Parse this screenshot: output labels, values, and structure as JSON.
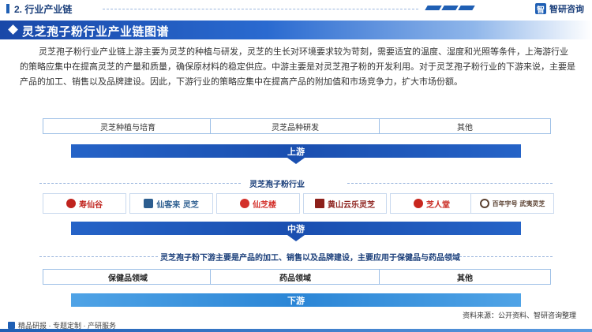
{
  "header": {
    "section_title": "2. 行业产业链",
    "brand_name": "智研咨询",
    "brand_logo_letter": "智"
  },
  "title": "灵芝孢子粉行业产业链图谱",
  "intro": "灵芝孢子粉行业产业链上游主要为灵芝的种植与研发，灵芝的生长对环境要求较为苛刻，需要适宜的温度、湿度和光照等条件，上海游行业的策略应集中在提高灵芝的产量和质量，确保原材料的稳定供应。中游主要是对灵芝孢子粉的开发利用。对于灵芝孢子粉行业的下游来说，主要是产品的加工、销售以及品牌建设。因此，下游行业的策略应集中在提高产品的附加值和市场竞争力，扩大市场份额。",
  "upstream": {
    "items": [
      "灵芝种植与培育",
      "灵芝品种研发",
      "其他"
    ],
    "label": "上游"
  },
  "midstream": {
    "heading": "灵芝孢子粉行业",
    "logos": [
      {
        "name": "寿仙谷",
        "color": "#c0241e",
        "icon": "red-seal-icon"
      },
      {
        "name": "仙客来 灵芝",
        "color": "#2c5d8f",
        "icon": "calligraphy-icon"
      },
      {
        "name": "仙芝楼",
        "color": "#d3302a",
        "icon": "red-circle-icon"
      },
      {
        "name": "黄山云乐灵芝",
        "color": "#8c1f1a",
        "icon": "red-block-icon"
      },
      {
        "name": "芝人堂",
        "color": "#c8261d",
        "icon": "red-mark-icon"
      },
      {
        "name": "百年字号 武夷灵芝",
        "color": "#5a4030",
        "icon": "round-stamp-icon"
      }
    ],
    "label": "中游"
  },
  "downstream": {
    "heading": "灵芝孢子粉下游主要是产品的加工、销售以及品牌建设，主要应用于保健品与药品领域",
    "items": [
      "保健品领域",
      "药品领域",
      "其他"
    ],
    "label": "下游"
  },
  "footer": {
    "left_text": "精品研报 · 专题定制 · 产研服务",
    "source": "资料来源：公开资料、智研咨询整理"
  },
  "colors": {
    "primary": "#1f5fb4",
    "dark_blue": "#1a4fb0",
    "light_blue": "#2b86d6",
    "border": "#9dbfe6"
  }
}
